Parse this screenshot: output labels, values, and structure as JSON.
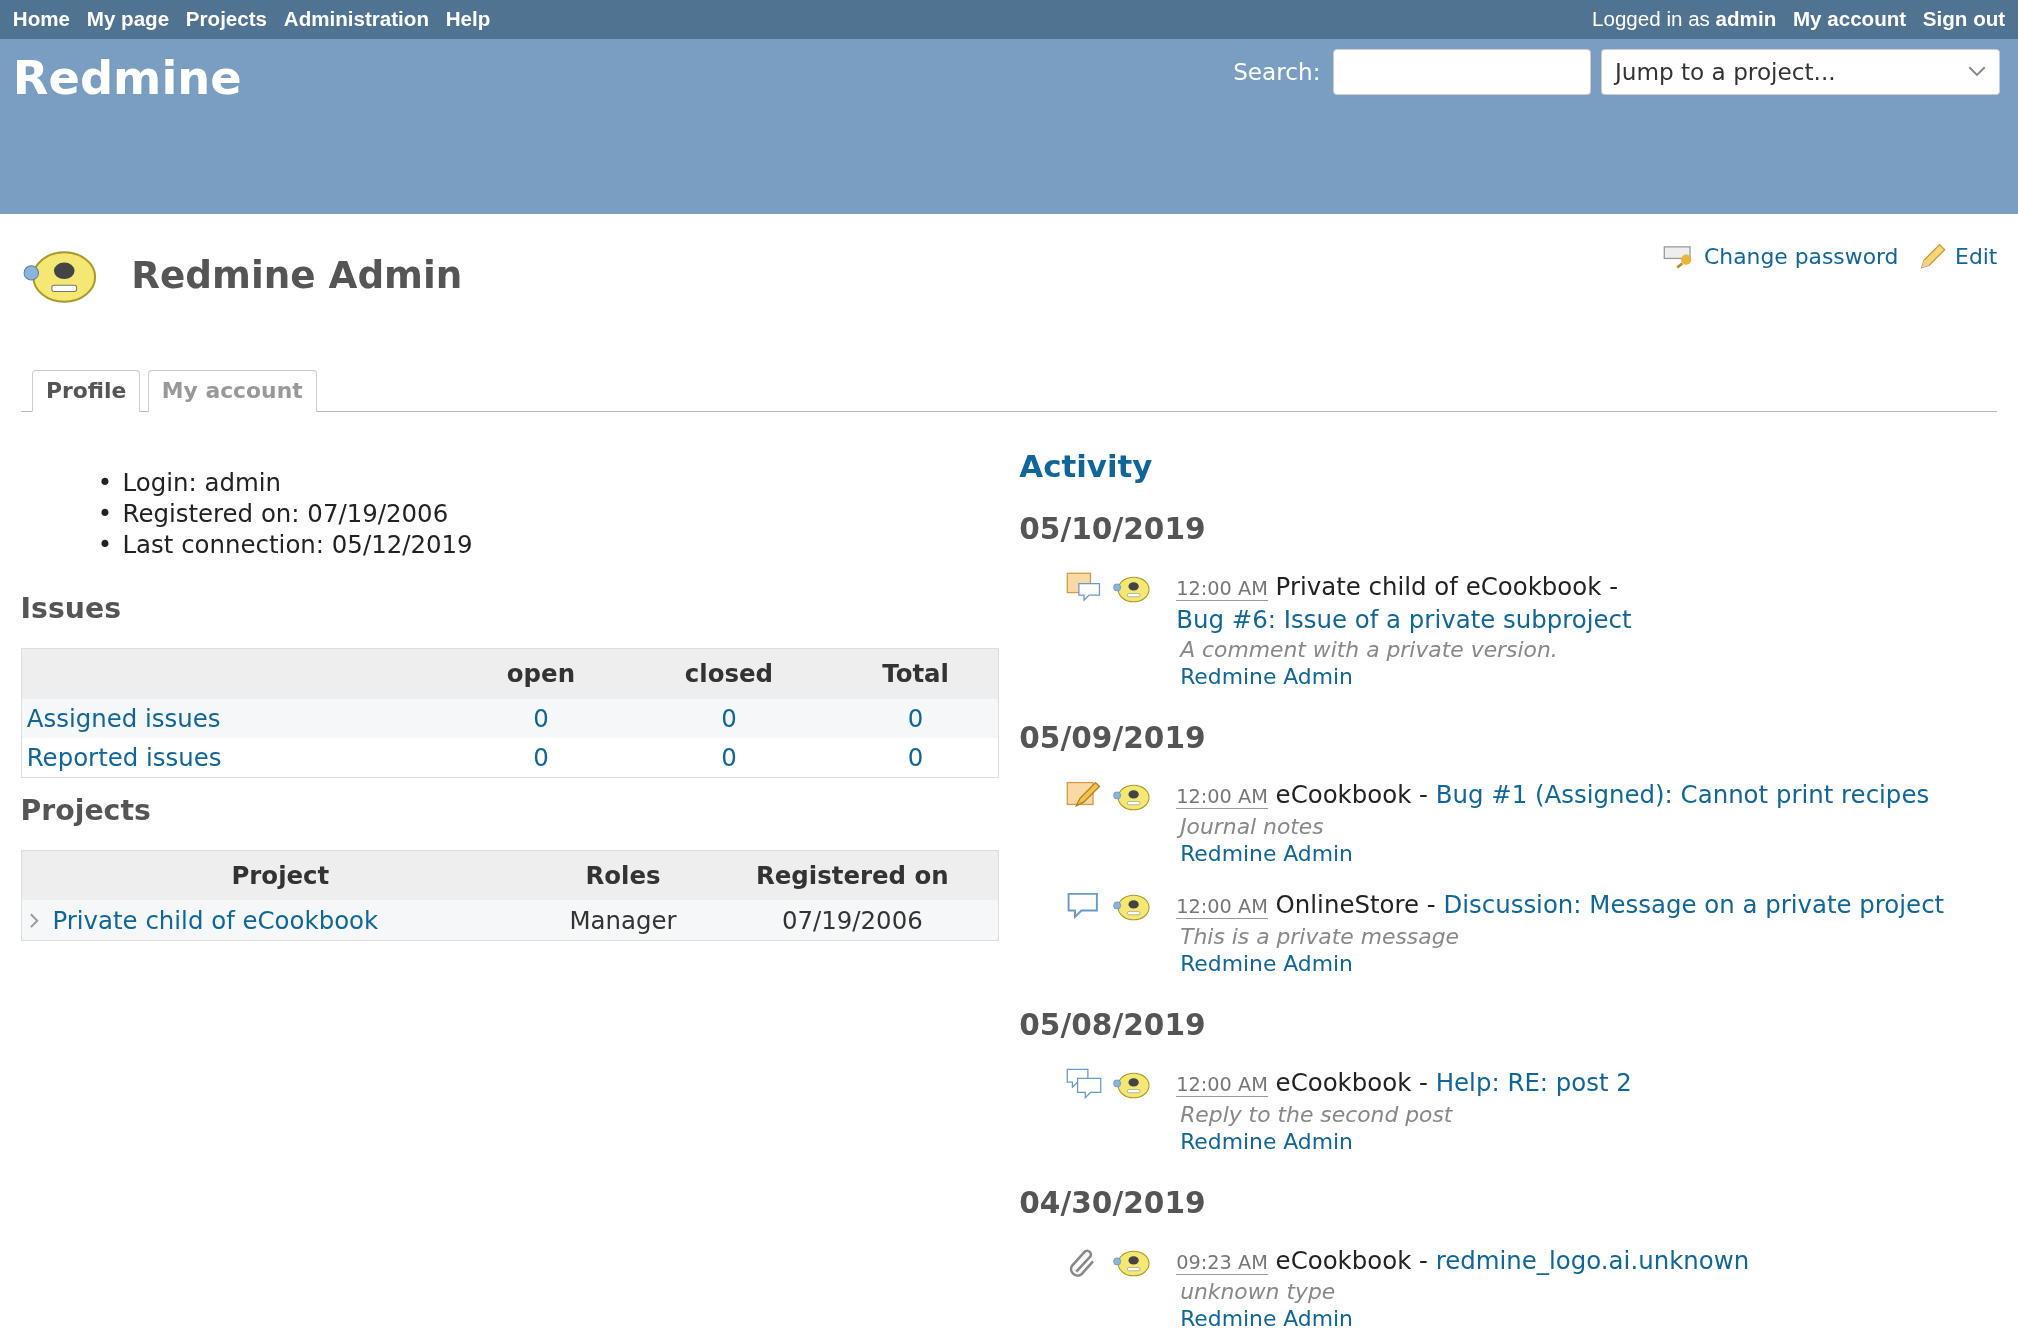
{
  "top_menu": [
    "Home",
    "My page",
    "Projects",
    "Administration",
    "Help"
  ],
  "account": {
    "prefix": "Logged in as",
    "user": "admin",
    "links": [
      "My account",
      "Sign out"
    ]
  },
  "header": {
    "title": "Redmine",
    "search_label": "Search:",
    "jump_placeholder": "Jump to a project..."
  },
  "user": {
    "name": "Redmine Admin",
    "actions": [
      {
        "kind": "password",
        "label": "Change password"
      },
      {
        "kind": "edit",
        "label": "Edit"
      }
    ]
  },
  "tabs": [
    {
      "label": "Profile",
      "selected": true
    },
    {
      "label": "My account",
      "selected": false
    }
  ],
  "profile": [
    {
      "bullet": "•",
      "text": "Login: admin"
    },
    {
      "bullet": "•",
      "text": "Registered on: 07/19/2006"
    },
    {
      "bullet": "•",
      "text": "Last connection: 05/12/2019"
    }
  ],
  "issues": {
    "title": "Issues",
    "columns": [
      "open",
      "closed",
      "Total"
    ],
    "rows": [
      {
        "label": "Assigned issues",
        "cells": [
          "0",
          "0",
          "0"
        ]
      },
      {
        "label": "Reported issues",
        "cells": [
          "0",
          "0",
          "0"
        ]
      }
    ]
  },
  "projects": {
    "title": "Projects",
    "columns": [
      "Project",
      "Roles",
      "Registered on"
    ],
    "rows": [
      {
        "project": "Private child of eCookbook",
        "roles": "Manager",
        "registered": "07/19/2006",
        "expanded": false
      }
    ]
  },
  "activity": {
    "title": "Activity",
    "days": [
      {
        "date": "05/10/2019",
        "events": [
          {
            "kind": "issue-note",
            "time": "12:00 AM",
            "project": "Private child of eCookbook -",
            "link": "Bug #6: Issue of a private subproject",
            "description": "A comment with a private version.",
            "author": "Redmine Admin"
          }
        ]
      },
      {
        "date": "05/09/2019",
        "events": [
          {
            "kind": "issue-edit",
            "time": "12:00 AM",
            "project": "eCookbook -",
            "link": "Bug #1 (Assigned): Cannot print recipes",
            "description": "Journal notes",
            "author": "Redmine Admin"
          },
          {
            "kind": "message",
            "time": "12:00 AM",
            "project": "OnlineStore -",
            "link": "Discussion: Message on a private project",
            "description": "This is a private message",
            "author": "Redmine Admin"
          }
        ]
      },
      {
        "date": "05/08/2019",
        "events": [
          {
            "kind": "reply",
            "time": "12:00 AM",
            "project": "eCookbook -",
            "link": "Help: RE: post 2",
            "description": "Reply to the second post",
            "author": "Redmine Admin"
          }
        ]
      },
      {
        "date": "04/30/2019",
        "events": [
          {
            "kind": "attachment",
            "time": "09:23 AM",
            "project": "eCookbook -",
            "link": "redmine_logo.ai.unknown",
            "description": "unknown type",
            "author": "Redmine Admin"
          }
        ]
      }
    ]
  }
}
